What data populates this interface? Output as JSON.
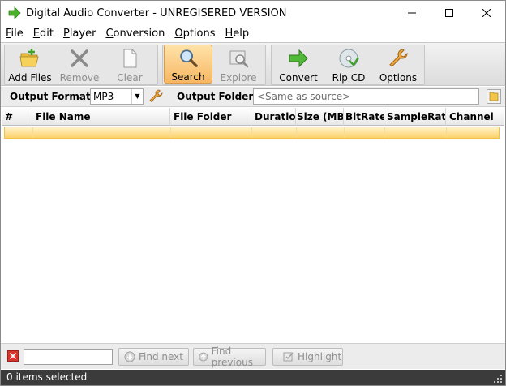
{
  "window": {
    "title": "Digital Audio Converter - UNREGISERED VERSION"
  },
  "menu": [
    {
      "key": "F",
      "rest": "ile"
    },
    {
      "key": "E",
      "rest": "dit"
    },
    {
      "key": "P",
      "rest": "layer"
    },
    {
      "key": "C",
      "rest": "onversion"
    },
    {
      "key": "O",
      "rest": "ptions"
    },
    {
      "key": "H",
      "rest": "elp"
    }
  ],
  "toolbar": {
    "add_files": "Add Files",
    "remove": "Remove",
    "clear": "Clear",
    "search": "Search",
    "explore": "Explore",
    "convert": "Convert",
    "rip_cd": "Rip CD",
    "options": "Options"
  },
  "format_row": {
    "output_format_label": "Output Format:",
    "output_format_value": "MP3",
    "output_folder_label": "Output Folder:",
    "output_folder_placeholder": "<Same as source>"
  },
  "grid": {
    "columns": [
      "#",
      "File Name",
      "File Folder",
      "Duration",
      "Size (MB)",
      "BitRate",
      "SampleRate",
      "Channel"
    ]
  },
  "findbar": {
    "find_next": "Find next",
    "find_previous": "Find previous",
    "highlight": "Highlight"
  },
  "status": {
    "text": "0 items selected"
  },
  "colors": {
    "accent_highlight": "#f7b764",
    "selected_row": "#fcd26a",
    "statusbar_bg": "#3b3b3b"
  }
}
